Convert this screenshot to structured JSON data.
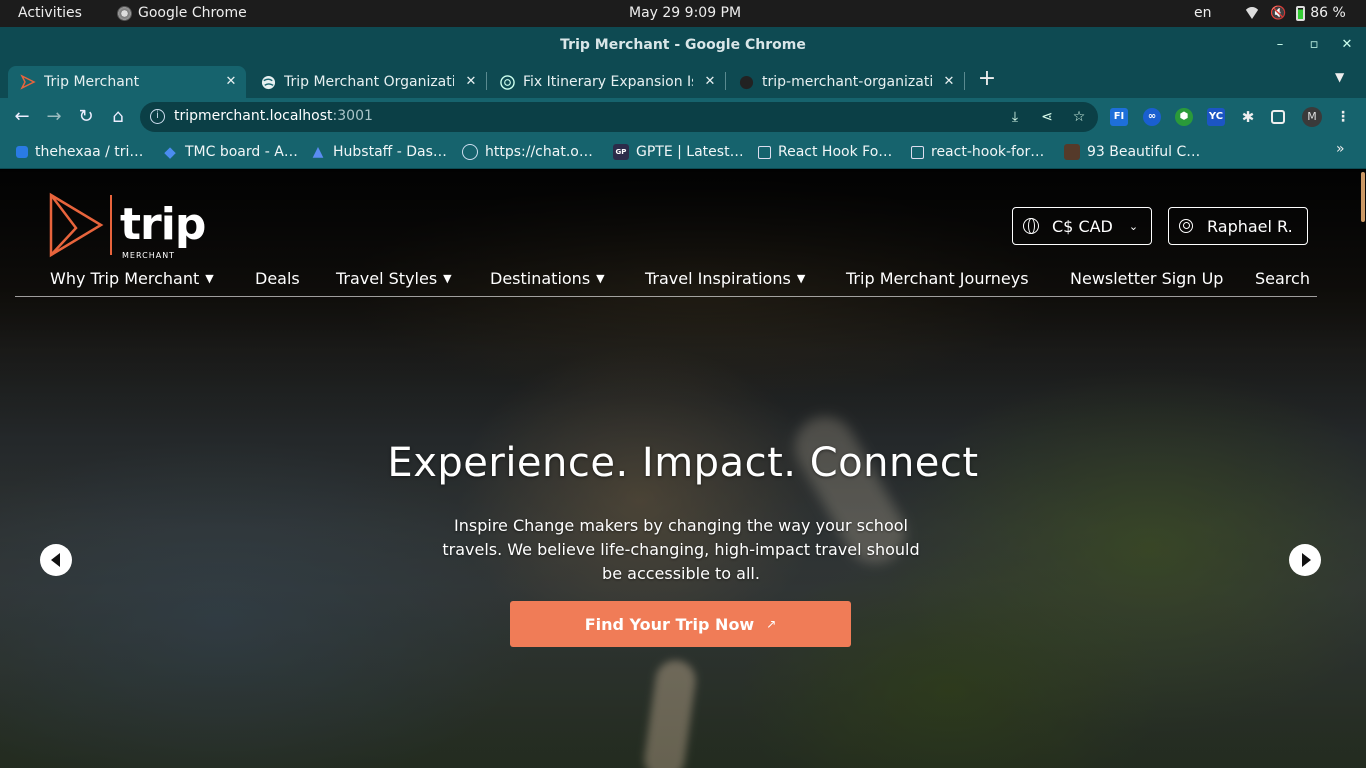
{
  "os_bar": {
    "activities": "Activities",
    "app_name": "Google Chrome",
    "clock": "May 29  9:09 PM",
    "lang": "en",
    "battery": "86 %"
  },
  "window": {
    "title": "Trip Merchant - Google Chrome",
    "minimize": "–",
    "maximize": "▫",
    "close": "✕"
  },
  "tabs": [
    {
      "label": "Trip Merchant",
      "icon": "trip-merchant-favicon",
      "active": true
    },
    {
      "label": "Trip Merchant Organizati",
      "icon": "globe-icon",
      "active": false
    },
    {
      "label": "Fix Itinerary Expansion Iss",
      "icon": "chatgpt-icon",
      "active": false
    },
    {
      "label": "trip-merchant-organizatio",
      "icon": "github-icon",
      "active": false
    }
  ],
  "new_tab": "+",
  "toolbar": {
    "url_host": "tripmerchant.localhost",
    "url_port": ":3001",
    "profile_initial": "M",
    "extensions": [
      {
        "label": "FI",
        "color": "#1e6fd9"
      },
      {
        "label": "∞",
        "color": "#1a5fd0"
      },
      {
        "label": "⬢",
        "color": "#2a9a3a"
      },
      {
        "label": "YC",
        "color": "#1c55c4"
      }
    ]
  },
  "bookmarks": [
    {
      "label": "thehexaa / tri…",
      "icon": "bitbucket-icon",
      "color": "#2a7be4"
    },
    {
      "label": "TMC board - A…",
      "icon": "jira-icon",
      "color": "#2e6fe3"
    },
    {
      "label": "Hubstaff - Das…",
      "icon": "hubstaff-icon",
      "color": "#4b7be8"
    },
    {
      "label": "https://chat.o…",
      "icon": "chatgpt-icon",
      "color": "#6a8c8a"
    },
    {
      "label": "GPTE | Latest…",
      "icon": "gpte-icon",
      "color": "#3a3a6a"
    },
    {
      "label": "React Hook Fo…",
      "icon": "page-icon",
      "color": "transparent"
    },
    {
      "label": "react-hook-for…",
      "icon": "page-icon",
      "color": "transparent"
    },
    {
      "label": "93 Beautiful C…",
      "icon": "bookmark-site-icon",
      "color": "#553a2a"
    }
  ],
  "site": {
    "logo_word": "trip",
    "logo_sub": "MERCHANT",
    "currency": "C$ CAD",
    "user": "Raphael R.",
    "nav": [
      {
        "label": "Why Trip Merchant",
        "dropdown": true
      },
      {
        "label": "Deals",
        "dropdown": false
      },
      {
        "label": "Travel Styles",
        "dropdown": true
      },
      {
        "label": "Destinations",
        "dropdown": true
      },
      {
        "label": "Travel Inspirations",
        "dropdown": true
      },
      {
        "label": "Trip Merchant Journeys",
        "dropdown": false
      },
      {
        "label": "Newsletter Sign Up",
        "dropdown": false
      },
      {
        "label": "Search",
        "dropdown": false
      }
    ],
    "hero": {
      "title": "Experience. Impact. Connect",
      "subtitle": "Inspire Change makers by changing the way your school travels. We believe life-changing, high-impact travel should be accessible to all.",
      "cta": "Find Your Trip Now",
      "cta_arrow": "↗"
    },
    "accent": "#f07c57"
  }
}
